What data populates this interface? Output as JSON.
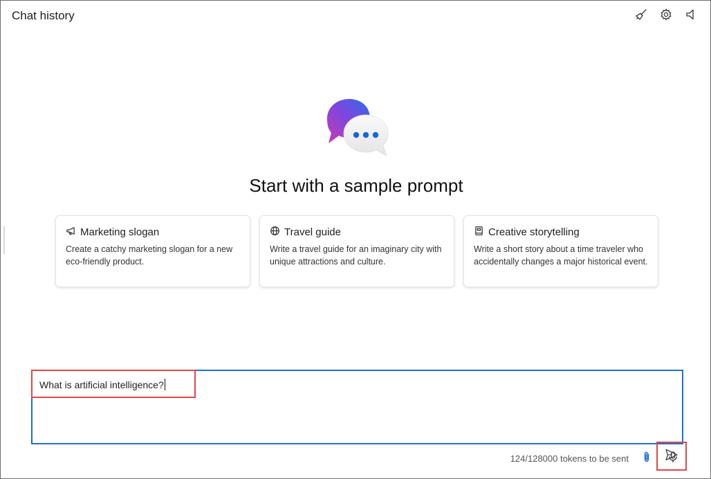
{
  "window": {
    "title": "Chat history"
  },
  "toolbar": {
    "icons": [
      "broom-icon",
      "gear-icon",
      "speaker-icon"
    ]
  },
  "hero": {
    "heading": "Start with a sample prompt"
  },
  "cards": [
    {
      "icon": "megaphone-icon",
      "title": "Marketing slogan",
      "description": "Create a catchy marketing slogan for a new eco-friendly product."
    },
    {
      "icon": "globe-icon",
      "title": "Travel guide",
      "description": "Write a travel guide for an imaginary city with unique attractions and culture."
    },
    {
      "icon": "book-icon",
      "title": "Creative storytelling",
      "description": "Write a short story about a time traveler who accidentally changes a major historical event."
    }
  ],
  "composer": {
    "value": "What is artificial intelligence?",
    "token_status": "124/128000 tokens to be sent"
  },
  "colors": {
    "accent_blue": "#1e6fd0",
    "highlight_red": "#e0464a"
  }
}
